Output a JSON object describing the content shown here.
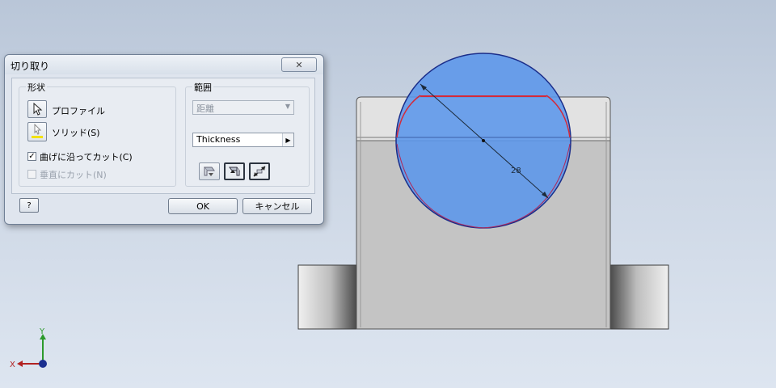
{
  "dialog": {
    "title": "切り取り",
    "close_glyph": "✕",
    "shape_group": {
      "label": "形状",
      "profile_label": "プロファイル",
      "solid_label": "ソリッド(S)",
      "cut_along_bends_label": "曲げに沿ってカット(C)",
      "cut_along_bends_checked": true,
      "perpendicular_cut_label": "垂直にカット(N)",
      "perpendicular_cut_checked": false
    },
    "extent_group": {
      "label": "範囲",
      "type_value": "距離",
      "distance_value": "Thickness"
    },
    "help_glyph": "?",
    "ok_label": "OK",
    "cancel_label": "キャンセル"
  },
  "viewport": {
    "dimension_value": "28",
    "axis_x_label": "X",
    "axis_y_label": "Y"
  },
  "colors": {
    "circle_fill": "#5b96ea",
    "circle_stroke": "#1a2d8a",
    "profile_red": "#d42a3a",
    "part_face": "#c4c4c4"
  }
}
